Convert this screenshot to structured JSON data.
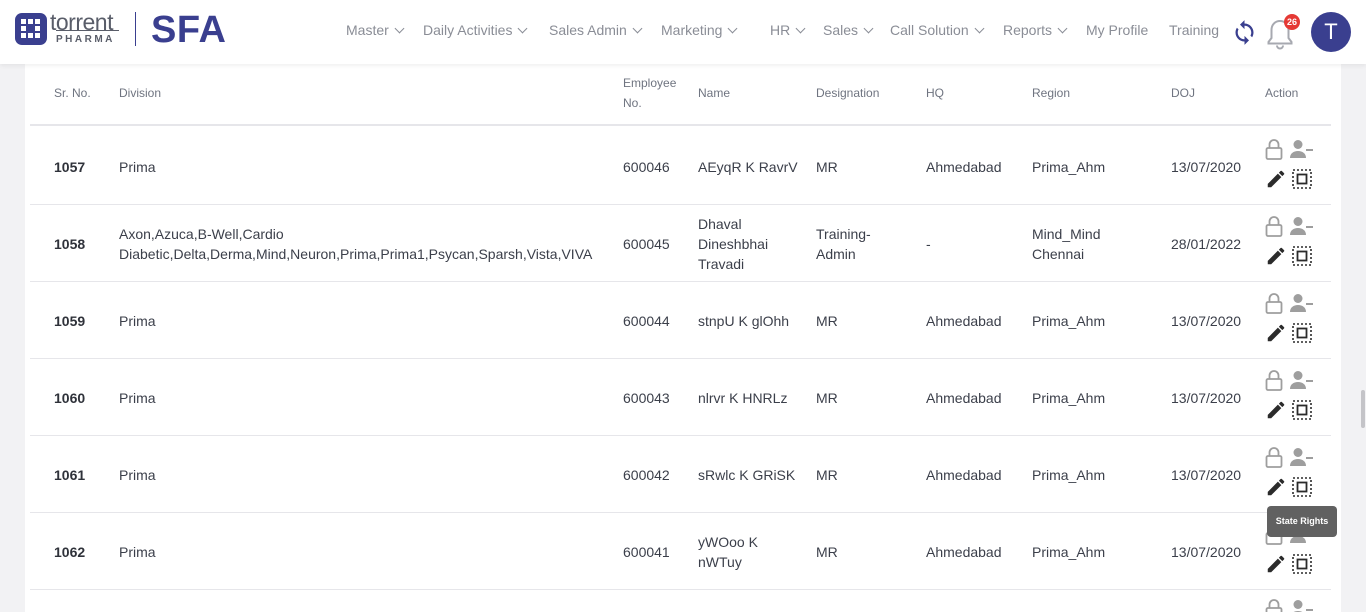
{
  "brand": {
    "company": "torrent",
    "company_sub": "PHARMA",
    "app": "SFA"
  },
  "nav": {
    "items": [
      {
        "label": "Master",
        "dropdown": true
      },
      {
        "label": "Daily Activities",
        "dropdown": true
      },
      {
        "label": "Sales Admin",
        "dropdown": true
      },
      {
        "label": "Marketing",
        "dropdown": true
      },
      {
        "label": "HR",
        "dropdown": true
      },
      {
        "label": "Sales",
        "dropdown": true
      },
      {
        "label": "Call Solution",
        "dropdown": true
      },
      {
        "label": "Reports",
        "dropdown": true
      },
      {
        "label": "My Profile",
        "dropdown": false
      },
      {
        "label": "Training",
        "dropdown": false
      }
    ],
    "notification_count": "26",
    "avatar_initial": "T"
  },
  "table": {
    "headers": {
      "srno": "Sr. No.",
      "division": "Division",
      "emp_no_line1": "Employee",
      "emp_no_line2": "No.",
      "name": "Name",
      "designation": "Designation",
      "hq": "HQ",
      "region": "Region",
      "doj": "DOJ",
      "action": "Action"
    },
    "rows": [
      {
        "srno": "1057",
        "division": [
          "Prima"
        ],
        "emp_no": "600046",
        "name": [
          "AEyqR K RavrV"
        ],
        "designation": [
          "MR"
        ],
        "hq": "Ahmedabad",
        "region": [
          "Prima_Ahm"
        ],
        "doj": "13/07/2020"
      },
      {
        "srno": "1058",
        "division": [
          "Axon,Azuca,B-Well,Cardio",
          "Diabetic,Delta,Derma,Mind,Neuron,Prima,Prima1,Psycan,Sparsh,Vista,VIVA"
        ],
        "emp_no": "600045",
        "name": [
          "Dhaval",
          "Dineshbhai",
          "Travadi"
        ],
        "designation": [
          "Training-",
          "Admin"
        ],
        "hq": "-",
        "region": [
          "Mind_Mind",
          "Chennai"
        ],
        "doj": "28/01/2022"
      },
      {
        "srno": "1059",
        "division": [
          "Prima"
        ],
        "emp_no": "600044",
        "name": [
          "stnpU K glOhh"
        ],
        "designation": [
          "MR"
        ],
        "hq": "Ahmedabad",
        "region": [
          "Prima_Ahm"
        ],
        "doj": "13/07/2020"
      },
      {
        "srno": "1060",
        "division": [
          "Prima"
        ],
        "emp_no": "600043",
        "name": [
          "nlrvr K HNRLz"
        ],
        "designation": [
          "MR"
        ],
        "hq": "Ahmedabad",
        "region": [
          "Prima_Ahm"
        ],
        "doj": "13/07/2020"
      },
      {
        "srno": "1061",
        "division": [
          "Prima"
        ],
        "emp_no": "600042",
        "name": [
          "sRwlc K GRiSK"
        ],
        "designation": [
          "MR"
        ],
        "hq": "Ahmedabad",
        "region": [
          "Prima_Ahm"
        ],
        "doj": "13/07/2020"
      },
      {
        "srno": "1062",
        "division": [
          "Prima"
        ],
        "emp_no": "600041",
        "name": [
          "yWOoo K",
          "nWTuy"
        ],
        "designation": [
          "MR"
        ],
        "hq": "Ahmedabad",
        "region": [
          "Prima_Ahm"
        ],
        "doj": "13/07/2020"
      }
    ]
  },
  "tooltip": "State Rights",
  "colors": {
    "brand": "#3a3f8f",
    "badge": "#e53935",
    "nav_text": "#8a8d96",
    "tooltip_bg": "#616161"
  }
}
